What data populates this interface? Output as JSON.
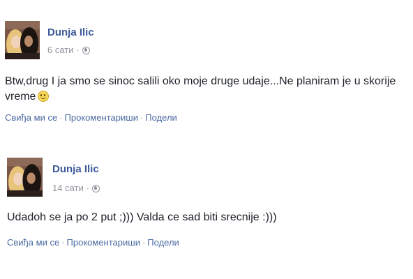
{
  "posts": [
    {
      "author": "Dunja Ilic",
      "time": "6 сати",
      "separator": "·",
      "text": "Btw,drug I ja smo se sinoc salili oko moje druge udaje...Ne planiram je u skorije vreme",
      "emoji": "smiley-icon",
      "actions": {
        "like": "Свиђа ми се",
        "comment": "Прокоментариши",
        "share": "Подели"
      }
    },
    {
      "author": "Dunja Ilic",
      "time": "14 сати",
      "separator": "·",
      "text": "Udadoh se ja po 2 put ;))) Valda ce sad biti srecnije :)))",
      "actions": {
        "like": "Свиђа ми се",
        "comment": "Прокоментариши",
        "share": "Подели"
      }
    }
  ],
  "colors": {
    "author": "#3b5998",
    "link": "#4b6aa3",
    "meta": "#90949c",
    "text": "#1d2129"
  }
}
